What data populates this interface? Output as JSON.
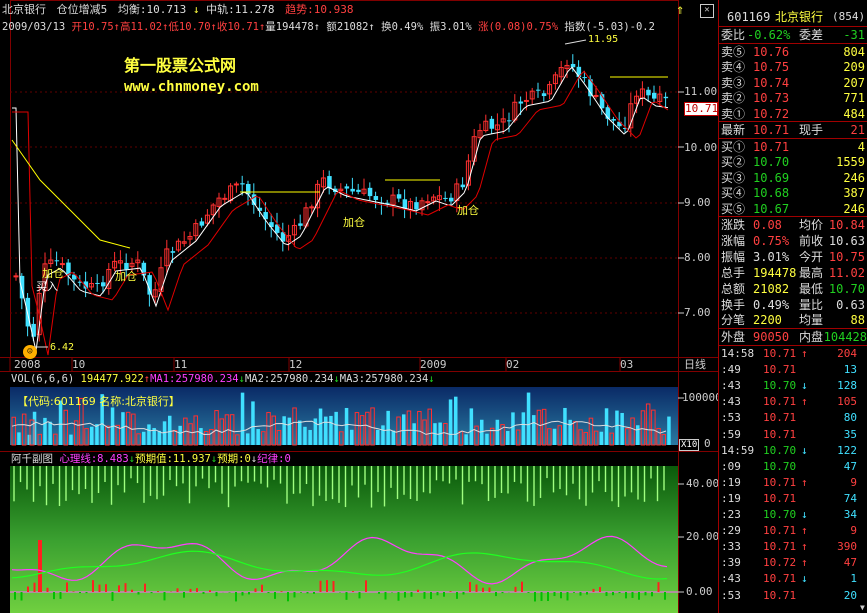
{
  "header": {
    "stock_name": "北京银行",
    "indicator": "仓位增减5",
    "avg_label": "均衡:10.713",
    "mid_label": "中轨:11.278",
    "trend_label": "趋势:10.938",
    "date": "2009/03/13",
    "open": "开10.75",
    "high": "高11.02",
    "low": "低10.70",
    "close": "收10.71",
    "volume": "量194478",
    "amount": "额21082",
    "turnover": "换0.49%",
    "amplitude": "振3.01%",
    "change": "涨(0.08)0.75%",
    "index_label": "指数(-5.03)-0.2"
  },
  "watermark": {
    "title": "第一股票公式网",
    "url": "www.chnmoney.com"
  },
  "main_chart": {
    "y_labels": [
      "11.00",
      "10.00",
      "9.00",
      "8.00",
      "7.00"
    ],
    "price_tag": "10.71",
    "high_annot": "11.95",
    "low_annot": "6.42",
    "annotations": {
      "buy": "买入",
      "add1": "加仓",
      "add2": "加仓",
      "add3": "加仓",
      "add4": "加仓"
    },
    "x_labels": [
      "2008",
      "10",
      "11",
      "12",
      "2009",
      "02",
      "03"
    ],
    "period": "日线"
  },
  "volume_chart": {
    "title": "VOL(6,6,6)",
    "vol": "194477.922",
    "ma1": "MA1:257980.234",
    "ma2": "MA2:257980.234",
    "ma3": "MA3:257980.234",
    "info": "【代码:601169 名称:北京银行】",
    "y_label": "100000",
    "y_zero": "0",
    "unit": "X10"
  },
  "sub_chart": {
    "name": "阿千副图",
    "xl": "心理线:8.483",
    "yqz": "预期值:11.937",
    "yq": "预期:0",
    "jl": "纪律:0",
    "y_labels": [
      "40.00",
      "20.00",
      "0.00"
    ]
  },
  "panel": {
    "code": "601169",
    "name": "北京银行",
    "num": "(854)",
    "wb_label": "委比",
    "wb_value": "-0.62%",
    "wc_label": "委差",
    "wc_value": "-31",
    "sells": [
      {
        "label": "卖⑤",
        "price": "10.76",
        "vol": "804"
      },
      {
        "label": "卖④",
        "price": "10.75",
        "vol": "209"
      },
      {
        "label": "卖③",
        "price": "10.74",
        "vol": "207"
      },
      {
        "label": "卖②",
        "price": "10.73",
        "vol": "771"
      },
      {
        "label": "卖①",
        "price": "10.72",
        "vol": "484"
      }
    ],
    "last_label": "最新",
    "last_value": "10.71",
    "hand_label": "现手",
    "hand_value": "21",
    "buys": [
      {
        "label": "买①",
        "price": "10.71",
        "vol": "4"
      },
      {
        "label": "买②",
        "price": "10.70",
        "vol": "1559"
      },
      {
        "label": "买③",
        "price": "10.69",
        "vol": "246"
      },
      {
        "label": "买④",
        "price": "10.68",
        "vol": "387"
      },
      {
        "label": "买⑤",
        "price": "10.67",
        "vol": "246"
      }
    ],
    "stats": [
      {
        "l1": "涨跌",
        "v1": "0.08",
        "l2": "均价",
        "v2": "10.84"
      },
      {
        "l1": "涨幅",
        "v1": "0.75%",
        "l2": "前收",
        "v2": "10.63"
      },
      {
        "l1": "振幅",
        "v1": "3.01%",
        "l2": "今开",
        "v2": "10.75"
      },
      {
        "l1": "总手",
        "v1": "194478",
        "l2": "最高",
        "v2": "11.02"
      },
      {
        "l1": "总额",
        "v1": "21082",
        "l2": "最低",
        "v2": "10.70"
      },
      {
        "l1": "换手",
        "v1": "0.49%",
        "l2": "量比",
        "v2": "0.63"
      },
      {
        "l1": "分笔",
        "v1": "2200",
        "l2": "均量",
        "v2": "88"
      }
    ],
    "outer_label": "外盘",
    "outer_value": "90050",
    "inner_label": "内盘",
    "inner_value": "104428",
    "ticks": [
      {
        "t": "14:58",
        "p": "10.71",
        "d": "↑",
        "v": "204"
      },
      {
        "t": ":49",
        "p": "10.71",
        "d": "",
        "v": "13"
      },
      {
        "t": ":43",
        "p": "10.70",
        "d": "↓",
        "v": "128"
      },
      {
        "t": ":43",
        "p": "10.71",
        "d": "↑",
        "v": "105"
      },
      {
        "t": ":53",
        "p": "10.71",
        "d": "",
        "v": "80"
      },
      {
        "t": ":59",
        "p": "10.71",
        "d": "",
        "v": "35"
      },
      {
        "t": "14:59",
        "p": "10.70",
        "d": "↓",
        "v": "122"
      },
      {
        "t": ":09",
        "p": "10.70",
        "d": "",
        "v": "47"
      },
      {
        "t": ":19",
        "p": "10.71",
        "d": "↑",
        "v": "9"
      },
      {
        "t": ":19",
        "p": "10.71",
        "d": "",
        "v": "74"
      },
      {
        "t": ":23",
        "p": "10.70",
        "d": "↓",
        "v": "34"
      },
      {
        "t": ":29",
        "p": "10.71",
        "d": "↑",
        "v": "9"
      },
      {
        "t": ":33",
        "p": "10.71",
        "d": "↑",
        "v": "390"
      },
      {
        "t": ":39",
        "p": "10.72",
        "d": "↑",
        "v": "47"
      },
      {
        "t": ":43",
        "p": "10.71",
        "d": "↓",
        "v": "1"
      },
      {
        "t": ":53",
        "p": "10.71",
        "d": "",
        "v": "20"
      }
    ]
  },
  "colors": {
    "up": "#ff3030",
    "down": "#40e0ff",
    "ma_white": "#ffffff",
    "ma_yellow": "#ffff00",
    "ma_red": "#e00000",
    "grid": "#800000"
  }
}
